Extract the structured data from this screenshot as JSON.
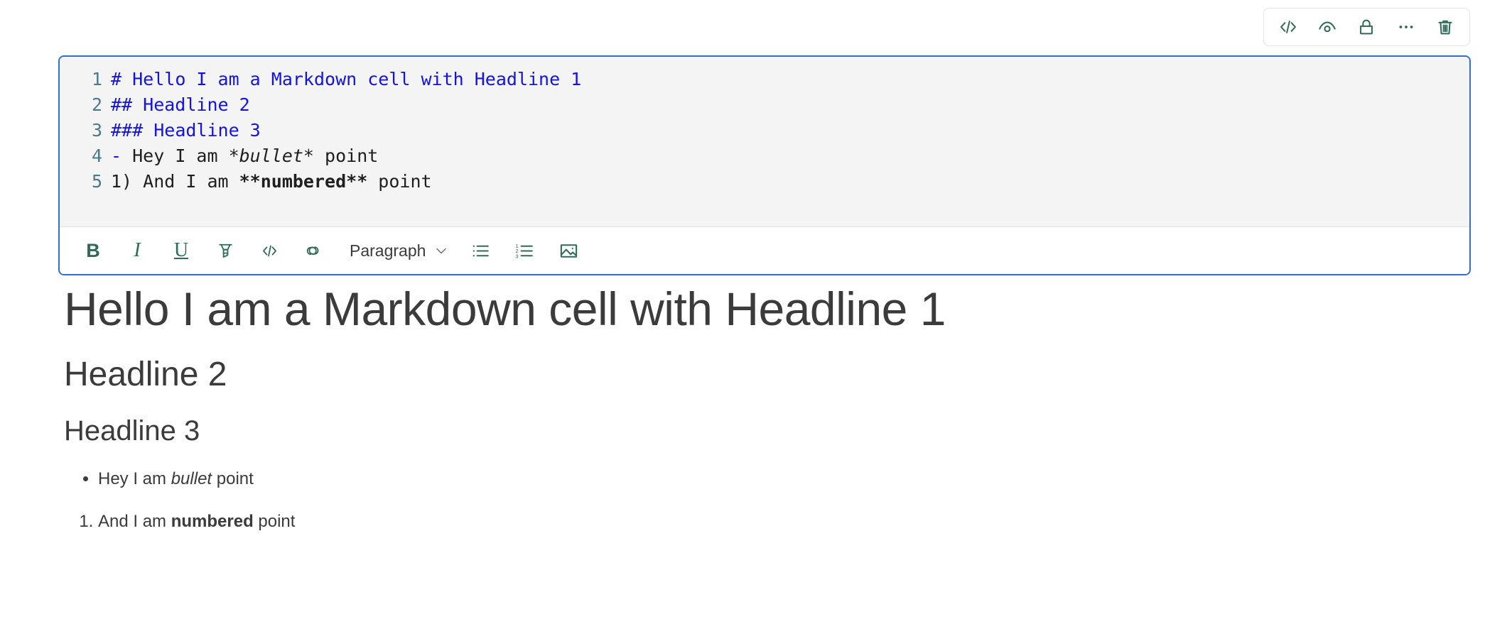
{
  "cell_toolbar": {
    "buttons": [
      {
        "name": "code-icon",
        "label": "Show code",
        "glyph": "</>"
      },
      {
        "name": "eye-icon",
        "label": "Preview",
        "glyph": "eye"
      },
      {
        "name": "lock-icon",
        "label": "Lock cell",
        "glyph": "lock"
      },
      {
        "name": "ellipsis-icon",
        "label": "More options",
        "glyph": "..."
      },
      {
        "name": "trash-icon",
        "label": "Delete cell",
        "glyph": "trash"
      }
    ]
  },
  "editor": {
    "language": "markdown",
    "line_numbers": [
      "1",
      "2",
      "3",
      "4",
      "5"
    ],
    "lines": [
      {
        "number": "1",
        "marker": "# ",
        "text": "Hello I am a Markdown cell with Headline 1",
        "style": "heading"
      },
      {
        "number": "2",
        "marker": "## ",
        "text": "Headline 2",
        "style": "heading"
      },
      {
        "number": "3",
        "marker": "### ",
        "text": "Headline 3",
        "style": "heading"
      },
      {
        "number": "4",
        "marker": "- ",
        "text": "Hey I am *bullet* point",
        "style": "bullet"
      },
      {
        "number": "5",
        "marker": "1) ",
        "text": "And I am **numbered** point",
        "style": "ordered"
      }
    ],
    "raw_line_4": {
      "prefix": "Hey I am ",
      "emphasis": "*bullet*",
      "suffix": " point"
    },
    "raw_line_5": {
      "ordinal": "1) ",
      "prefix": "And I am ",
      "strong": "**numbered**",
      "suffix": " point"
    }
  },
  "format_toolbar": {
    "bold_label": "B",
    "italic_label": "I",
    "underline_label": "U",
    "highlight_label": "Highlight",
    "code_label": "</>",
    "link_label": "Link",
    "block_style": "Paragraph",
    "bulleted_list_label": "Bulleted list",
    "numbered_list_label": "Numbered list",
    "image_label": "Insert image",
    "numbered_list_digits": [
      "1",
      "2",
      "3"
    ]
  },
  "preview": {
    "h1": "Hello I am a Markdown cell with Headline 1",
    "h2": "Headline 2",
    "h3": "Headline 3",
    "bullet_item": {
      "prefix": "Hey I am ",
      "em": "bullet",
      "suffix": " point"
    },
    "ordered_item": {
      "prefix": "And I am ",
      "strong": "numbered",
      "suffix": " point"
    }
  },
  "colors": {
    "editor_border": "#2f6fd0",
    "code_background": "#f4f4f4",
    "line_number": "#4a7b8a",
    "markdown_heading": "#1414e0",
    "toolbar_icon": "#2d6a58",
    "text": "#3b3b3b"
  }
}
